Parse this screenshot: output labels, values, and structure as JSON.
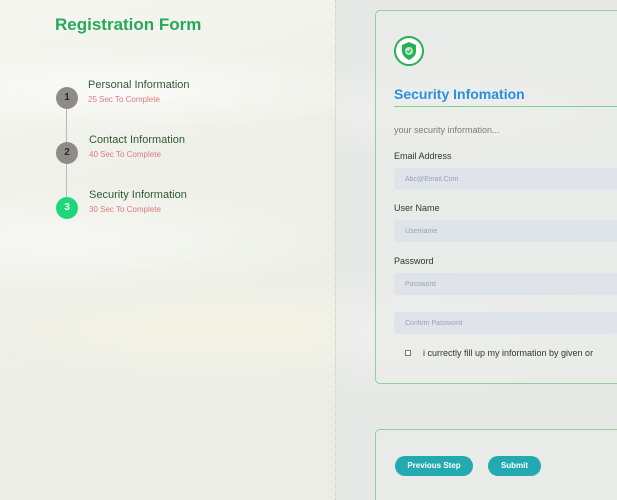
{
  "form": {
    "title": "Registration Form"
  },
  "steps": [
    {
      "number": "1",
      "title": "Personal Information",
      "subtitle": "25 Sec To Complete",
      "active": false
    },
    {
      "number": "2",
      "title": "Contact Information",
      "subtitle": "40 Sec To Complete",
      "active": false
    },
    {
      "number": "3",
      "title": "Security Information",
      "subtitle": "30 Sec To Complete",
      "active": true
    }
  ],
  "security": {
    "icon": "shield-check-icon",
    "title": "Security Infomation",
    "description": "your security information...",
    "email_label": "Email Address",
    "email_placeholder": "Abc@Email.Com",
    "email_value": "",
    "username_label": "User Name",
    "username_placeholder": "Username",
    "username_value": "",
    "password_label": "Password",
    "password_placeholder": "Password",
    "password_value": "",
    "confirm_placeholder": "Confirm Password",
    "confirm_value": "",
    "agree_text": "i currectly fill up my information by given or",
    "agree_checked": false
  },
  "nav": {
    "previous_label": "Previous Step",
    "submit_label": "Submit"
  },
  "colors": {
    "accent_green": "#27a85a",
    "active_step": "#1fd67a",
    "title_blue": "#2a8fe0",
    "button_teal": "#23aab0",
    "step_sub_pink": "#e07a82"
  }
}
